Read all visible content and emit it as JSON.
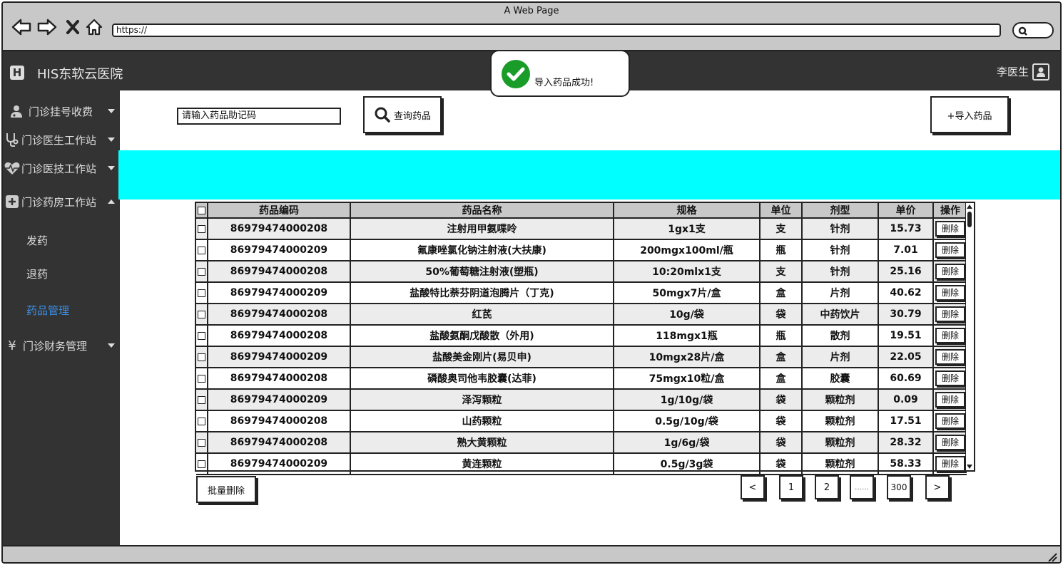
{
  "browser": {
    "window_title": "A Web Page",
    "url": "https://"
  },
  "app": {
    "title": "HIS东软云医院",
    "logo_letter": "H",
    "user_name": "李医生"
  },
  "sidebar": {
    "menus": [
      {
        "label": "门诊挂号收费",
        "icon": "doctor-icon",
        "expanded": false
      },
      {
        "label": "门诊医生工作站",
        "icon": "stethoscope-icon",
        "expanded": false
      },
      {
        "label": "门诊医技工作站",
        "icon": "heartbeat-icon",
        "expanded": false
      },
      {
        "label": "门诊药房工作站",
        "icon": "plus-box-icon",
        "expanded": true
      },
      {
        "label": "门诊财务管理",
        "icon": "yen-icon",
        "expanded": false
      }
    ],
    "submenu": [
      {
        "label": "发药",
        "active": false
      },
      {
        "label": "退药",
        "active": false
      },
      {
        "label": "药品管理",
        "active": true
      }
    ]
  },
  "toolbar": {
    "search_placeholder": "请输入药品助记码",
    "search_button": "查询药品",
    "import_button": "+导入药品"
  },
  "toast": {
    "message": "导入药品成功!"
  },
  "table": {
    "headers": [
      "药品编码",
      "药品名称",
      "规格",
      "单位",
      "剂型",
      "单价",
      "操作"
    ],
    "delete_label": "删除",
    "rows": [
      {
        "code": "86979474000208",
        "name": "注射用甲氨喋呤",
        "spec": "1gx1支",
        "unit": "支",
        "form": "针剂",
        "price": "15.73"
      },
      {
        "code": "86979474000209",
        "name": "氟康唑氯化钠注射液(大扶康)",
        "spec": "200mgx100ml/瓶",
        "unit": "瓶",
        "form": "针剂",
        "price": "7.01"
      },
      {
        "code": "86979474000208",
        "name": "50%葡萄糖注射液(塑瓶)",
        "spec": "10:20mlx1支",
        "unit": "支",
        "form": "针剂",
        "price": "25.16"
      },
      {
        "code": "86979474000209",
        "name": "盐酸特比萘芬阴道泡腾片（丁克)",
        "spec": "50mgx7片/盒",
        "unit": "盒",
        "form": "片剂",
        "price": "40.62"
      },
      {
        "code": "86979474000208",
        "name": "红芪",
        "spec": "10g/袋",
        "unit": "袋",
        "form": "中药饮片",
        "price": "30.79"
      },
      {
        "code": "86979474000208",
        "name": "盐酸氨酮戊酸散（外用)",
        "spec": "118mgx1瓶",
        "unit": "瓶",
        "form": "散剂",
        "price": "19.51"
      },
      {
        "code": "86979474000209",
        "name": "盐酸美金刚片(易贝申)",
        "spec": "10mgx28片/盒",
        "unit": "盒",
        "form": "片剂",
        "price": "22.05"
      },
      {
        "code": "86979474000208",
        "name": "磷酸奥司他韦胶囊(达菲)",
        "spec": "75mgx10粒/盒",
        "unit": "盒",
        "form": "胶囊",
        "price": "60.69"
      },
      {
        "code": "86979474000209",
        "name": "泽泻颗粒",
        "spec": "1g/10g/袋",
        "unit": "袋",
        "form": "颗粒剂",
        "price": "0.09"
      },
      {
        "code": "86979474000208",
        "name": "山药颗粒",
        "spec": "0.5g/10g/袋",
        "unit": "袋",
        "form": "颗粒剂",
        "price": "17.51"
      },
      {
        "code": "86979474000208",
        "name": "熟大黄颗粒",
        "spec": "1g/6g/袋",
        "unit": "袋",
        "form": "颗粒剂",
        "price": "28.32"
      },
      {
        "code": "86979474000209",
        "name": "黄连颗粒",
        "spec": "0.5g/3g袋",
        "unit": "袋",
        "form": "颗粒剂",
        "price": "58.33"
      }
    ]
  },
  "batch_delete": "批量删除",
  "pagination": {
    "prev": "<",
    "pages": [
      "1",
      "2",
      "……",
      "300"
    ],
    "next": ">"
  },
  "colors": {
    "header_bg": "#333333",
    "banner": "#00ffff",
    "active_menu": "#3b8fe8",
    "success": "#1a9c28"
  }
}
